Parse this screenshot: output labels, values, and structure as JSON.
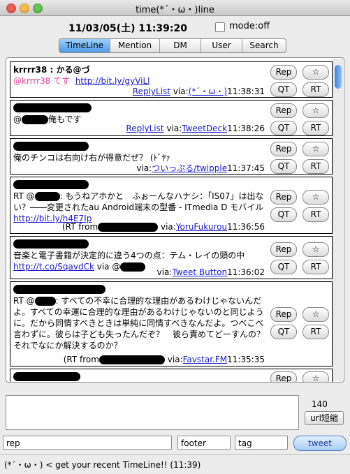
{
  "window": {
    "title": "time(*´・ω・)line"
  },
  "header": {
    "datetime": "11/03/05(土) 11:39:20",
    "mode_label": "mode:off"
  },
  "tabs": [
    "TimeLine",
    "Mention",
    "DM",
    "User",
    "Search"
  ],
  "buttons": {
    "rep": "Rep",
    "fav": "☆",
    "qt": "QT",
    "rt": "RT"
  },
  "tweets": [
    {
      "user": "krrrr38 : かる@づ",
      "mention": "@krrrr38 てす",
      "link": "http://bit.ly/gyViLl",
      "replylist": "ReplyList",
      "via_prefix": "via:",
      "client": "(*´・ω・)",
      "time": "11:38:31"
    },
    {
      "text_prefix": "@",
      "text_suffix": "俺もです",
      "replylist": "ReplyList",
      "via_prefix": "via:",
      "client": "TweetDeck",
      "time": "11:38:26"
    },
    {
      "text": "俺のチンコは右向け右が得意だぜ？ (ﾄﾞﾔｧ",
      "via_prefix": "via:",
      "client": "ついっぷる/twipple",
      "time": "11:37:45"
    },
    {
      "text_prefix": "RT @",
      "text_body": ": もうねアホかと　ふぉーんなハナシ：「IS07」は出ない？――変更されたau Android端末の型番 - ITmedia D モバイル",
      "link": "http://bit.ly/h4E7Ip",
      "rt_from": "(RT from",
      "via_prefix": "via:",
      "client": "YoruFukurou",
      "time": "11:36:56"
    },
    {
      "text": "音楽と電子書籍が決定的に違う4つの点：テム・レイの頭の中",
      "link": "http://t.co/SqavdCk",
      "via_at": "via @",
      "via_prefix": "via:",
      "client": "Tweet Button",
      "time": "11:36:02"
    },
    {
      "text_prefix": "RT @",
      "text_body": ": すべての不幸に合理的な理由があるわけじゃないんだよ。すべての幸運に合理的な理由があるわけじゃないのと同じように。だから同情すべきときは単純に同情すべきなんだよ。つべこべ言わずに。彼らは子ども失ったんだぞ？　彼ら責めてどーすんの？　それでなにか解決するのか？",
      "rt_from": "(RT from",
      "via_prefix": "via:",
      "client": "Favstar.FM",
      "time": "11:35:35"
    }
  ],
  "compose": {
    "count": "140",
    "url_button": "url短縮"
  },
  "fields": {
    "rep": "rep",
    "footer": "footer",
    "tag": "tag",
    "tweet_button": "tweet"
  },
  "status": {
    "text": "(*´・ω・) < get your recent TimeLine!! (11:39)"
  }
}
